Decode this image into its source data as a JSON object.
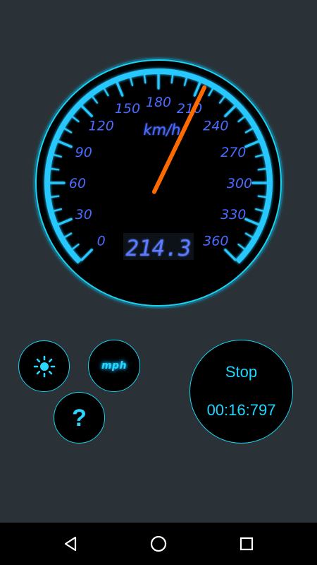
{
  "gauge": {
    "unit_label": "km/h",
    "scale_labels": [
      "0",
      "30",
      "60",
      "90",
      "120",
      "150",
      "180",
      "210",
      "240",
      "270",
      "300",
      "330",
      "360"
    ],
    "scale_max": 360,
    "needle_value": 214.3,
    "digital_readout": "214.3",
    "colors": {
      "ring": "#19d2f0",
      "scale": "#27c8ff",
      "labels": "#4a6cff",
      "needle": "#ff6a00",
      "readout": "#5b7bff"
    }
  },
  "controls": {
    "brightness_icon": "sun-icon",
    "mph_label": "mph",
    "help_label": "?",
    "stop_label": "Stop",
    "timer": "00:16:797"
  },
  "navbar": {
    "back_icon": "back-triangle-icon",
    "home_icon": "home-circle-icon",
    "recents_icon": "recents-square-icon"
  }
}
